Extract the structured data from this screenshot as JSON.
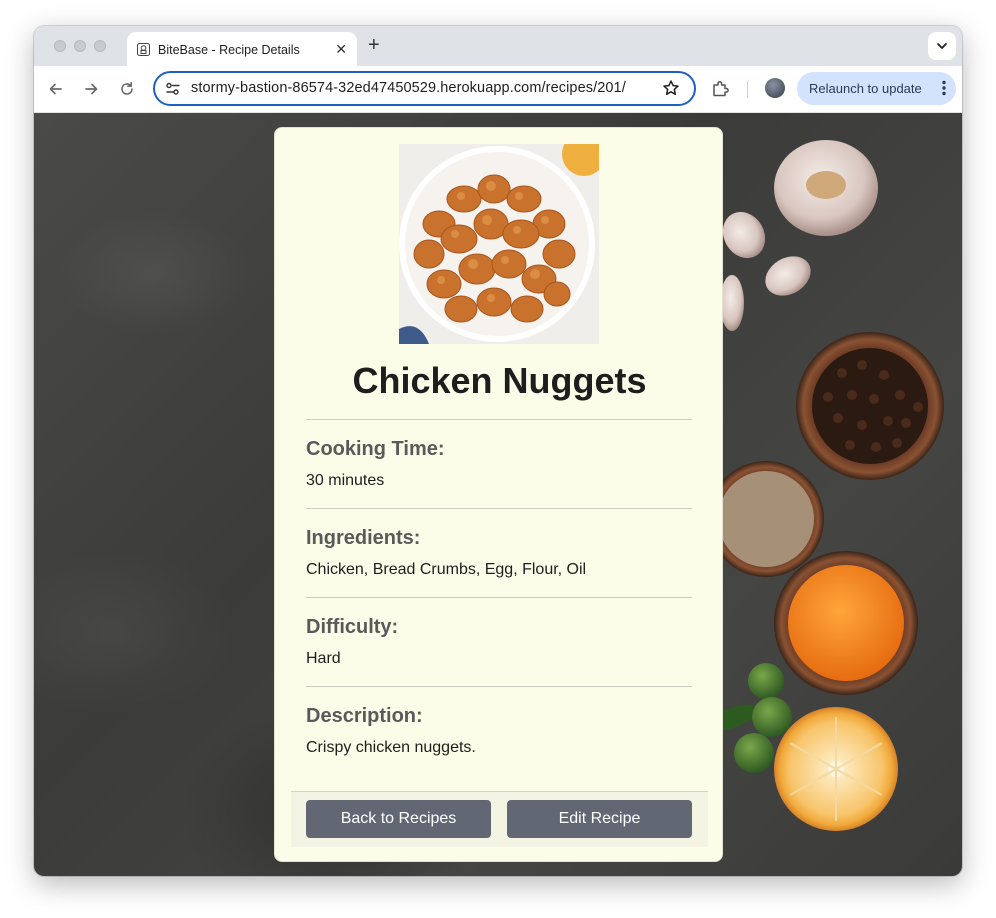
{
  "browser": {
    "tab_title": "BiteBase - Recipe Details",
    "url": "stormy-bastion-86574-32ed47450529.herokuapp.com/recipes/201/",
    "relaunch_label": "Relaunch to update"
  },
  "recipe": {
    "title": "Chicken Nuggets",
    "sections": [
      {
        "heading": "Cooking Time:",
        "value": "30 minutes"
      },
      {
        "heading": "Ingredients:",
        "value": "Chicken, Bread Crumbs, Egg, Flour, Oil"
      },
      {
        "heading": "Difficulty:",
        "value": "Hard"
      },
      {
        "heading": "Description:",
        "value": "Crispy chicken nuggets."
      }
    ]
  },
  "actions": {
    "back_label": "Back to Recipes",
    "edit_label": "Edit Recipe"
  },
  "colors": {
    "card_background": "#fbfde8",
    "button": "#616873",
    "omnibox_focus": "#1f5fbf",
    "relaunch_chip": "#d3e3fd"
  }
}
